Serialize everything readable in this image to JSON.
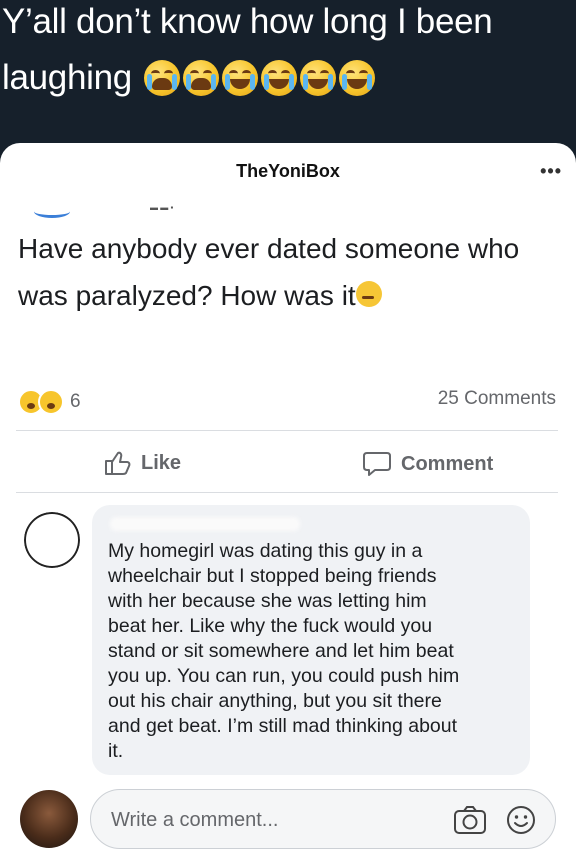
{
  "tweet": {
    "text": "Y’all don’t know how long I been laughing",
    "emojis": [
      "loudly-crying-face",
      "loudly-crying-face",
      "face-with-tears-of-joy",
      "face-with-tears-of-joy",
      "face-with-tears-of-joy",
      "face-with-tears-of-joy"
    ]
  },
  "post": {
    "page_name": "TheYoniBox",
    "more_icon": "more-options-icon",
    "question": "Have anybody ever dated someone who was paralyzed? How was it",
    "question_emoji": "face-with-raised-eyebrow",
    "reaction_icons": [
      "laughing-reaction-icon",
      "wow-reaction-icon"
    ],
    "reaction_count": "6",
    "comments_count": "25 Comments"
  },
  "actions": {
    "like_label": "Like",
    "comment_label": "Comment"
  },
  "comment": {
    "text": "My homegirl was dating this guy in a\nwheelchair but I stopped being friends\nwith her because she was letting him\nbeat her. Like why the fuck would you\nstand or sit somewhere and let him beat\nyou up. You can run, you could push him\nout his chair anything, but you sit there\nand get beat. I’m still mad thinking about\nit."
  },
  "composer": {
    "placeholder": "Write a comment...",
    "icons": [
      "camera-icon",
      "smiley-icon"
    ]
  },
  "colors": {
    "page_background": "#16202b",
    "card_background": "#ffffff",
    "bubble_background": "#f0f2f5",
    "secondary_text": "#65676b"
  }
}
